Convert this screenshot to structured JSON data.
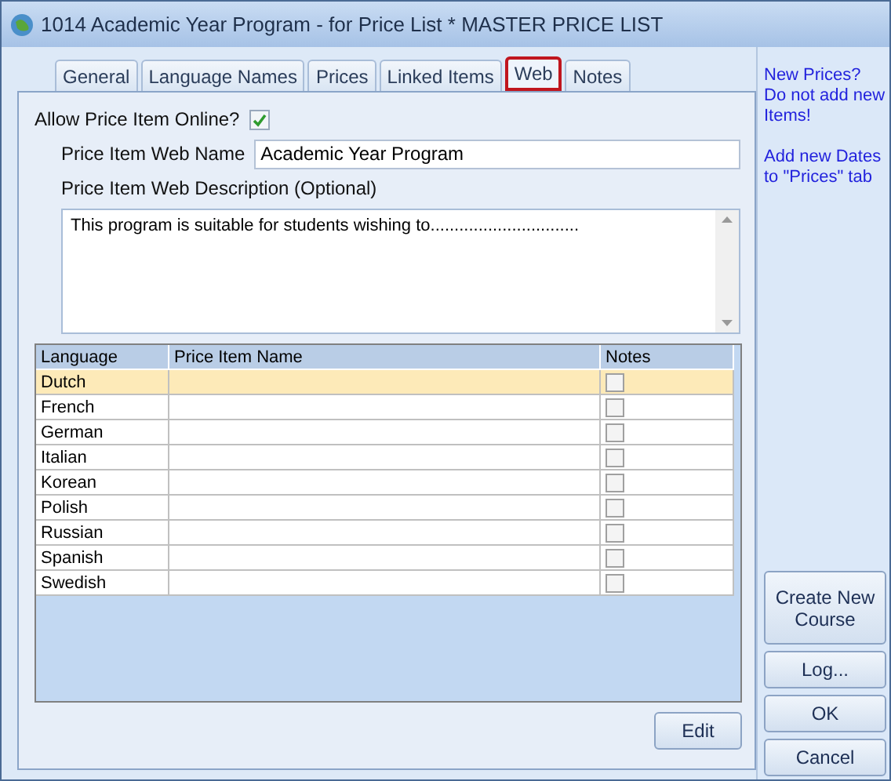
{
  "window": {
    "title": "1014 Academic Year Program - for Price List * MASTER PRICE LIST"
  },
  "tabs": [
    {
      "label": "General",
      "selected": false
    },
    {
      "label": "Language Names",
      "selected": false
    },
    {
      "label": "Prices",
      "selected": false
    },
    {
      "label": "Linked Items",
      "selected": false
    },
    {
      "label": "Web",
      "selected": true
    },
    {
      "label": "Notes",
      "selected": false
    }
  ],
  "allow_online": {
    "label": "Allow Price Item Online?",
    "checked": true
  },
  "web_name": {
    "label": "Price Item Web Name",
    "value": "Academic Year Program"
  },
  "web_description": {
    "label": "Price Item Web Description (Optional)",
    "value": "This program is suitable for students wishing to..............................."
  },
  "table": {
    "columns": [
      "Language",
      "Price Item Name",
      "Notes"
    ],
    "rows": [
      {
        "language": "Dutch",
        "name": "",
        "notes": false,
        "selected": true
      },
      {
        "language": "French",
        "name": "",
        "notes": false,
        "selected": false
      },
      {
        "language": "German",
        "name": "",
        "notes": false,
        "selected": false
      },
      {
        "language": "Italian",
        "name": "",
        "notes": false,
        "selected": false
      },
      {
        "language": "Korean",
        "name": "",
        "notes": false,
        "selected": false
      },
      {
        "language": "Polish",
        "name": "",
        "notes": false,
        "selected": false
      },
      {
        "language": "Russian",
        "name": "",
        "notes": false,
        "selected": false
      },
      {
        "language": "Spanish",
        "name": "",
        "notes": false,
        "selected": false
      },
      {
        "language": "Swedish",
        "name": "",
        "notes": false,
        "selected": false
      }
    ]
  },
  "edit_button": "Edit",
  "side_notes": [
    "New Prices? Do not add new Items!",
    "Add new Dates to \"Prices\" tab"
  ],
  "side_buttons": [
    "Create New Course",
    "Log...",
    "OK",
    "Cancel"
  ]
}
